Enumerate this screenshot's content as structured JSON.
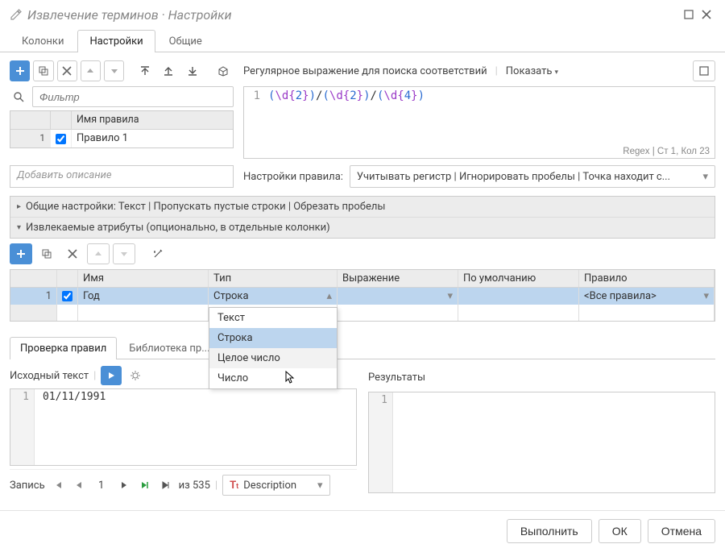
{
  "title": "Извлечение терминов · Настройки",
  "mainTabs": {
    "cols": "Колонки",
    "settings": "Настройки",
    "general": "Общие"
  },
  "filterPlaceholder": "Фильтр",
  "ruleTable": {
    "header": "Имя правила",
    "row1": {
      "num": "1",
      "name": "Правило 1"
    }
  },
  "regexBar": {
    "label": "Регулярное выражение для поиска соответствий",
    "show": "Показать"
  },
  "editor": {
    "line": "1",
    "g1a": "(",
    "g1b": "\\d{",
    "g1c": "2",
    "g1d": "}",
    "g1e": ")",
    "sep": "/",
    "g3a": "(",
    "g3b": "\\d{",
    "g3c": "4",
    "g3d": "}",
    "g3e": ")",
    "status": "Regex | Ст 1, Кол 23"
  },
  "descPlaceholder": "Добавить описание",
  "ruleProps": {
    "label": "Настройки правила:",
    "value": "Учитывать регистр | Игнорировать пробелы | Точка находит с..."
  },
  "acc": {
    "general": "Общие настройки: Текст | Пропускать пустые строки | Обрезать пробелы",
    "attrs": "Извлекаемые атрибуты (опционально, в отдельные колонки)"
  },
  "attrTable": {
    "h_name": "Имя",
    "h_type": "Тип",
    "h_expr": "Выражение",
    "h_def": "По умолчанию",
    "h_rule": "Правило",
    "row": {
      "num": "1",
      "name": "Год",
      "type": "Строка",
      "rule": "<Все правила>"
    }
  },
  "typeDropdown": {
    "opt1": "Текст",
    "opt2": "Строка",
    "opt3": "Целое число",
    "opt4": "Число"
  },
  "tabs2": {
    "check": "Проверка правил",
    "lib": "Библиотека пр..."
  },
  "preview": {
    "srcLabel": "Исходный текст",
    "resLabel": "Результаты",
    "srcLine": "1",
    "srcText": "01/11/1991",
    "resLine": "1"
  },
  "nav": {
    "record": "Запись",
    "page": "1",
    "total": "из 535",
    "field": "Description"
  },
  "footer": {
    "run": "Выполнить",
    "ok": "ОК",
    "cancel": "Отмена"
  }
}
